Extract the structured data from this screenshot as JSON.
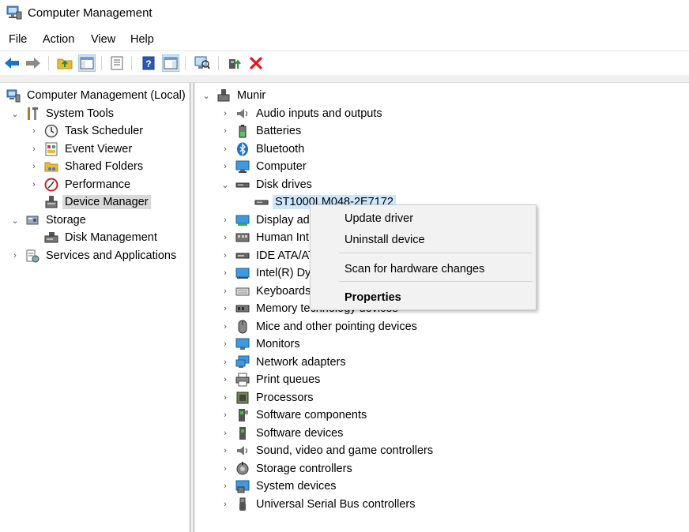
{
  "window": {
    "title": "Computer Management"
  },
  "menu": [
    "File",
    "Action",
    "View",
    "Help"
  ],
  "left_tree": [
    {
      "label": "Computer Management (Local)"
    },
    {
      "label": "System Tools"
    },
    {
      "label": "Task Scheduler"
    },
    {
      "label": "Event Viewer"
    },
    {
      "label": "Shared Folders"
    },
    {
      "label": "Performance"
    },
    {
      "label": "Device Manager"
    },
    {
      "label": "Storage"
    },
    {
      "label": "Disk Management"
    },
    {
      "label": "Services and Applications"
    }
  ],
  "device_tree": {
    "root": "Munir",
    "items": [
      "Audio inputs and outputs",
      "Batteries",
      "Bluetooth",
      "Computer",
      "Disk drives",
      "ST1000LM048-2E7172",
      "Display ad",
      "Human Int",
      "IDE ATA/AT",
      "Intel(R) Dy",
      "Keyboards",
      "Memory technology devices",
      "Mice and other pointing devices",
      "Monitors",
      "Network adapters",
      "Print queues",
      "Processors",
      "Software components",
      "Software devices",
      "Sound, video and game controllers",
      "Storage controllers",
      "System devices",
      "Universal Serial Bus controllers"
    ]
  },
  "context_menu": {
    "update_driver": "Update driver",
    "uninstall_device": "Uninstall device",
    "scan": "Scan for hardware changes",
    "properties": "Properties"
  },
  "colors": {
    "selection": "#cce8ff",
    "left_selection": "#d9d9d9",
    "delete_red": "#e81123",
    "back_arrow": "#1a73c9"
  }
}
